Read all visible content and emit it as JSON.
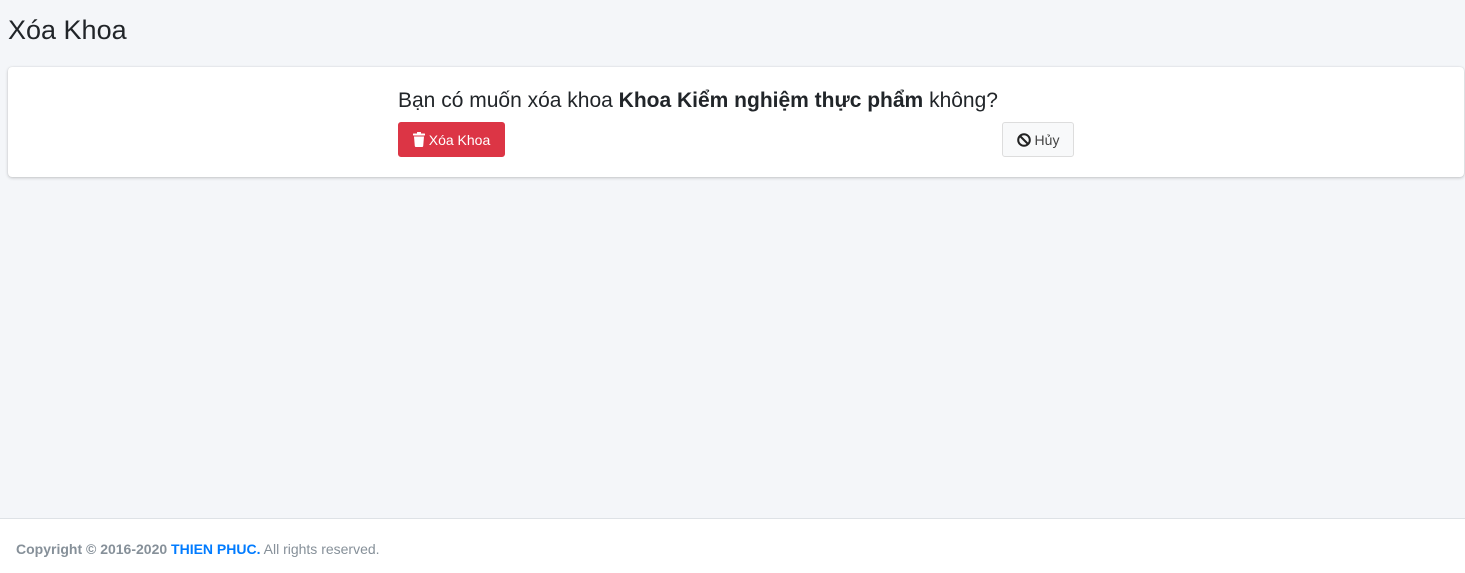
{
  "header": {
    "title": "Xóa Khoa"
  },
  "confirm": {
    "prefix": "Bạn có muốn xóa khoa ",
    "department_name": "Khoa Kiểm nghiệm thực phẩm",
    "suffix": " không?",
    "delete_label": "Xóa Khoa",
    "delete_icon": "trash-icon",
    "cancel_label": "Hủy",
    "cancel_icon": "ban-icon"
  },
  "footer": {
    "copyright": "Copyright © 2016-2020 ",
    "company": "THIEN PHUC.",
    "rights": " All rights reserved."
  },
  "colors": {
    "danger": "#dc3545",
    "link": "#007bff",
    "background": "#f4f6f9"
  }
}
